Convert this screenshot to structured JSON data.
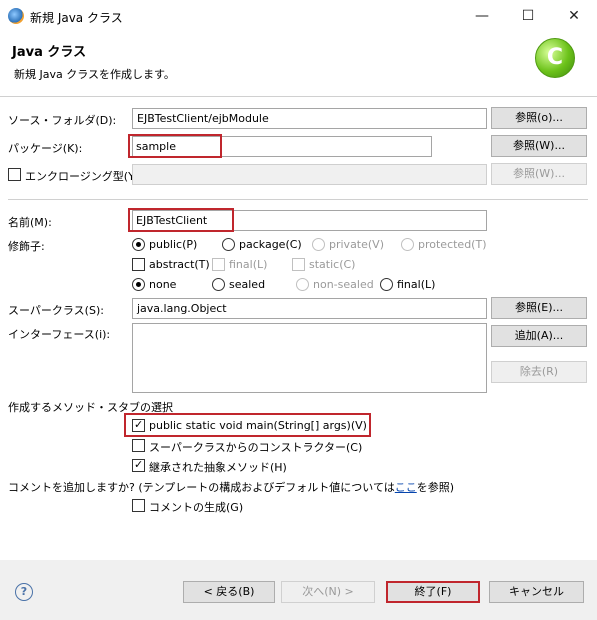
{
  "window": {
    "title": "新規 Java クラス",
    "minimize": "—",
    "maximize": "☐",
    "close": "✕"
  },
  "header": {
    "title": "Java クラス",
    "description": "新規 Java クラスを作成します。",
    "logo_letter": "C"
  },
  "form": {
    "source_folder_label": "ソース・フォルダ(D):",
    "source_folder_value": "EJBTestClient/ejbModule",
    "source_browse": "参照(o)...",
    "package_label": "パッケージ(K):",
    "package_value": "sample",
    "package_browse": "参照(W)...",
    "enclosing_label": "エンクロージング型(Y):",
    "enclosing_browse": "参照(W)...",
    "name_label": "名前(M):",
    "name_value": "EJBTestClient",
    "modifiers_label": "修飾子:",
    "mod_public": "public(P)",
    "mod_package": "package(C)",
    "mod_private": "private(V)",
    "mod_protected": "protected(T)",
    "mod_abstract": "abstract(T)",
    "mod_final": "final(L)",
    "mod_static": "static(C)",
    "mod_none": "none",
    "mod_sealed": "sealed",
    "mod_nonsealed": "non-sealed",
    "mod_final2": "final(L)",
    "superclass_label": "スーパークラス(S):",
    "superclass_value": "java.lang.Object",
    "superclass_browse": "参照(E)...",
    "interfaces_label": "インターフェース(i):",
    "interfaces_add": "追加(A)...",
    "interfaces_remove": "除去(R)"
  },
  "stubs": {
    "section_label": "作成するメソッド・スタブの選択",
    "main": "public static void main(String[] args)(V)",
    "constructors": "スーパークラスからのコンストラクター(C)",
    "inherited": "継承された抽象メソッド(H)"
  },
  "comments": {
    "question_prefix": "コメントを追加しますか? (テンプレートの構成およびデフォルト値については",
    "link": "ここ",
    "question_suffix": "を参照)",
    "generate": "コメントの生成(G)"
  },
  "footer": {
    "help": "?",
    "back": "< 戻る(B)",
    "next": "次へ(N) >",
    "finish": "終了(F)",
    "cancel": "キャンセル"
  },
  "colors": {
    "highlight": "#c0262d",
    "link": "#0645ad"
  }
}
